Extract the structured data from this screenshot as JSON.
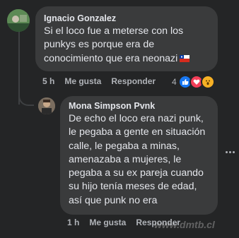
{
  "comment1": {
    "author": "Ignacio Gonzalez",
    "text": "Si el loco fue a meterse con los punkys es porque era de conocimiento que era neonazi",
    "time": "5 h",
    "like_label": "Me gusta",
    "reply_label": "Responder",
    "reaction_count": "4",
    "reaction_icons": [
      "like-icon",
      "love-icon",
      "wow-icon"
    ],
    "flag_icon": "chile-flag-icon"
  },
  "comment2": {
    "author": "Mona Simpson Pvnk",
    "text": "De echo el loco era nazi punk, le pegaba a gente en situación calle, le pegaba a minas, amenazaba a mujeres, le pegaba a su ex pareja cuando su hijo tenía meses de edad, así que punk no era",
    "time": "1 h",
    "like_label": "Me gusta",
    "reply_label": "Responder"
  },
  "watermark": "www.dmtb.cl",
  "colors": {
    "background": "#242526",
    "bubble": "#3a3b3c",
    "text": "#e4e6eb",
    "muted": "#b0b3b8",
    "like": "#1877f2",
    "love": "#f33e58",
    "wow": "#f7b125"
  }
}
